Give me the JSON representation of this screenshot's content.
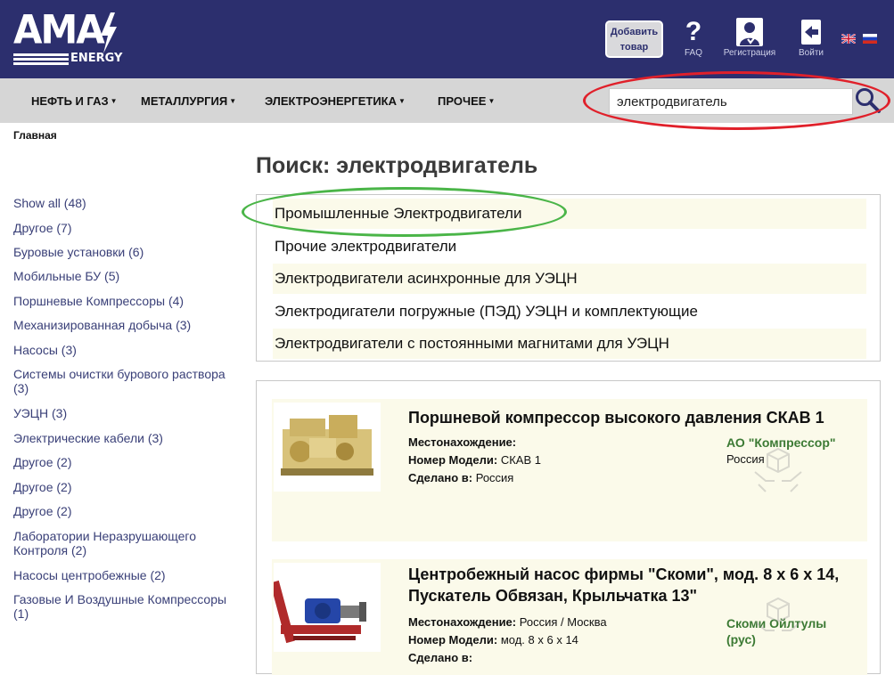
{
  "header": {
    "logo_text": "AMA",
    "logo_subtext": "ENERGY",
    "add_button": [
      "Добавить",
      "товар"
    ],
    "faq_label": "FAQ",
    "register_label": "Регистрация",
    "logout_label": "Войти"
  },
  "nav": {
    "items": [
      "НЕФТЬ И ГАЗ",
      "МЕТАЛЛУРГИЯ",
      "ЭЛЕКТРОЭНЕРГЕТИКА",
      "ПРОЧЕЕ"
    ],
    "search_value": "электродвигатель"
  },
  "breadcrumb": "Главная",
  "page_title": "Поиск: электродвигатель",
  "facets": [
    "Show all (48)",
    "Другое (7)",
    "Буровые установки (6)",
    "Мобильные БУ (5)",
    "Поршневые Компрессоры (4)",
    "Механизированная добыча (3)",
    "Насосы (3)",
    "Системы очистки бурового раствора (3)",
    "УЭЦН (3)",
    "Электрические кабели (3)",
    "Другое (2)",
    "Другое (2)",
    "Другое (2)",
    "Лаборатории Неразрушающего Контроля (2)",
    "Насосы центробежные (2)",
    "Газовые И Воздушные Компрессоры (1)"
  ],
  "categories": [
    "Промышленные Электродвигатели",
    "Прочие электродвигатели",
    "Электродвигатели асинхронные для УЭЦН",
    "Электродигатели погружные (ПЭД) УЭЦН и комплектующие",
    "Электродвигатели с постоянными магнитами для УЭЦН"
  ],
  "results": [
    {
      "title_lines": [
        "Поршневой компрессор высокого давления СКАВ 1"
      ],
      "location_label": "Местонахождение:",
      "location_value": "",
      "model_label": "Номер Модели:",
      "model_value": "СКАВ 1",
      "made_label": "Сделано в:",
      "made_value": "Россия",
      "company": "АО \"Компрессор\"",
      "country": "Россия"
    },
    {
      "title_lines": [
        "Центробежный насос фирмы \"Скоми\", мод. 8 х 6 х 14,",
        "Пускатель Обвязан, Крыльчатка 13\""
      ],
      "location_label": "Местонахождение:",
      "location_value": "Россия / Москва",
      "model_label": "Номер Модели:",
      "model_value": "мод. 8 х 6 х 14",
      "made_label": "Сделано в:",
      "made_value": "",
      "company": "Скоми Ойлтулы (рус)",
      "country": ""
    }
  ],
  "colors": {
    "header_bg": "#2c2f6e",
    "nav_bg": "#d6d6d6",
    "accent_green": "#3c7a34",
    "link_blue": "#3a4078",
    "highlight_red": "#e0202a",
    "highlight_green": "#4ab548",
    "row_tint": "#fbfaea"
  },
  "icons": [
    "lightning-bolt-logo",
    "question-icon",
    "user-check-icon",
    "logout-arrow-icon",
    "flag-uk-icon",
    "flag-ru-icon",
    "search-icon",
    "caret-down-icon",
    "box-hands-icon"
  ]
}
